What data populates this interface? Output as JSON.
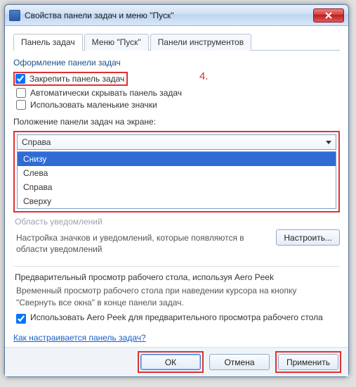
{
  "window": {
    "title": "Свойства панели задач и меню \"Пуск\""
  },
  "tabs": [
    {
      "label": "Панель задач",
      "active": true
    },
    {
      "label": "Меню \"Пуск\"",
      "active": false
    },
    {
      "label": "Панели инструментов",
      "active": false
    }
  ],
  "appearance": {
    "heading": "Оформление панели задач",
    "lock_label": "Закрепить панель задач",
    "lock_checked": true,
    "autohide_label": "Автоматически скрывать панель задач",
    "autohide_checked": false,
    "small_icons_label": "Использовать маленькие значки",
    "small_icons_checked": false
  },
  "annotation": {
    "marker": "4."
  },
  "position": {
    "heading": "Положение панели задач на экране:",
    "selected": "Справа",
    "options": [
      "Снизу",
      "Слева",
      "Справа",
      "Сверху"
    ],
    "highlighted_index": 0
  },
  "notify": {
    "heading_faded": "Область уведомлений",
    "desc": "Настройка значков и уведомлений, которые появляются в области уведомлений",
    "button": "Настроить..."
  },
  "aero": {
    "heading": "Предварительный просмотр рабочего стола, используя Aero Peek",
    "desc": "Временный просмотр рабочего стола при наведении курсора на кнопку \"Свернуть все окна\" в конце панели задач.",
    "check_label": "Использовать Aero Peek для предварительного просмотра рабочего стола",
    "check_checked": true
  },
  "help_link": "Как настраивается панель задач?",
  "footer": {
    "ok": "ОК",
    "cancel": "Отмена",
    "apply": "Применить"
  }
}
